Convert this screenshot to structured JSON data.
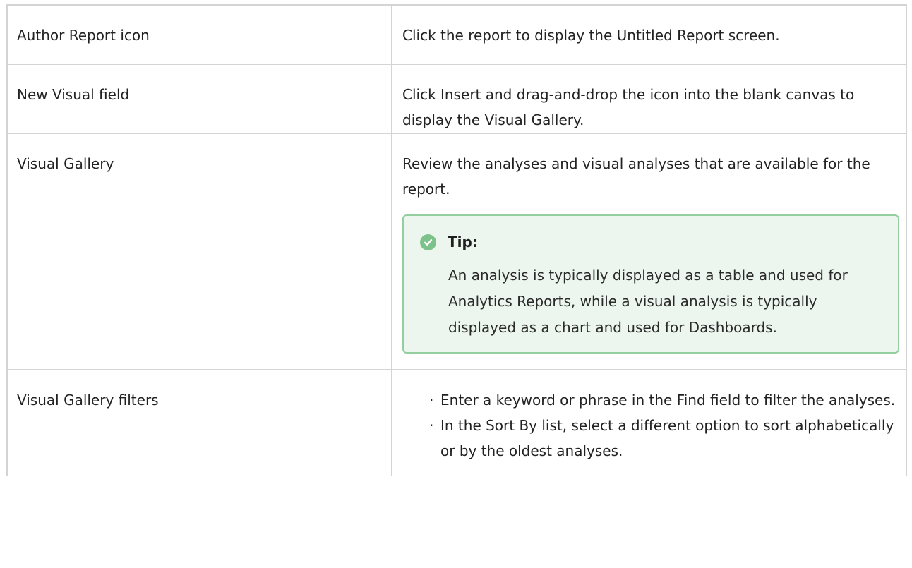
{
  "rows": [
    {
      "field": "Author Report icon",
      "description": "Click the report to display the Untitled Report screen."
    },
    {
      "field": "New Visual field",
      "description": "Click Insert and drag-and-drop the icon into the blank canvas to display the Visual Gallery."
    },
    {
      "field": "Visual Gallery",
      "description": "Review the analyses and visual analyses that are available for the report.",
      "tip": {
        "icon": "check-circle-icon",
        "title": "Tip:",
        "body": "An analysis is typically displayed as a table and used for Analytics Reports, while a visual analysis is typically displayed as a chart and used for Dashboards."
      }
    },
    {
      "field": "Visual Gallery filters",
      "bullets": [
        "Enter a keyword or phrase in the Find field to filter the analyses.",
        "In the Sort By list, select a different option to sort alphabetically or by the oldest analyses."
      ]
    }
  ],
  "colors": {
    "border": "#d4d4d4",
    "tip_border": "#93cf9e",
    "tip_background": "#ecf6ee",
    "tip_icon": "#7cc28a"
  }
}
